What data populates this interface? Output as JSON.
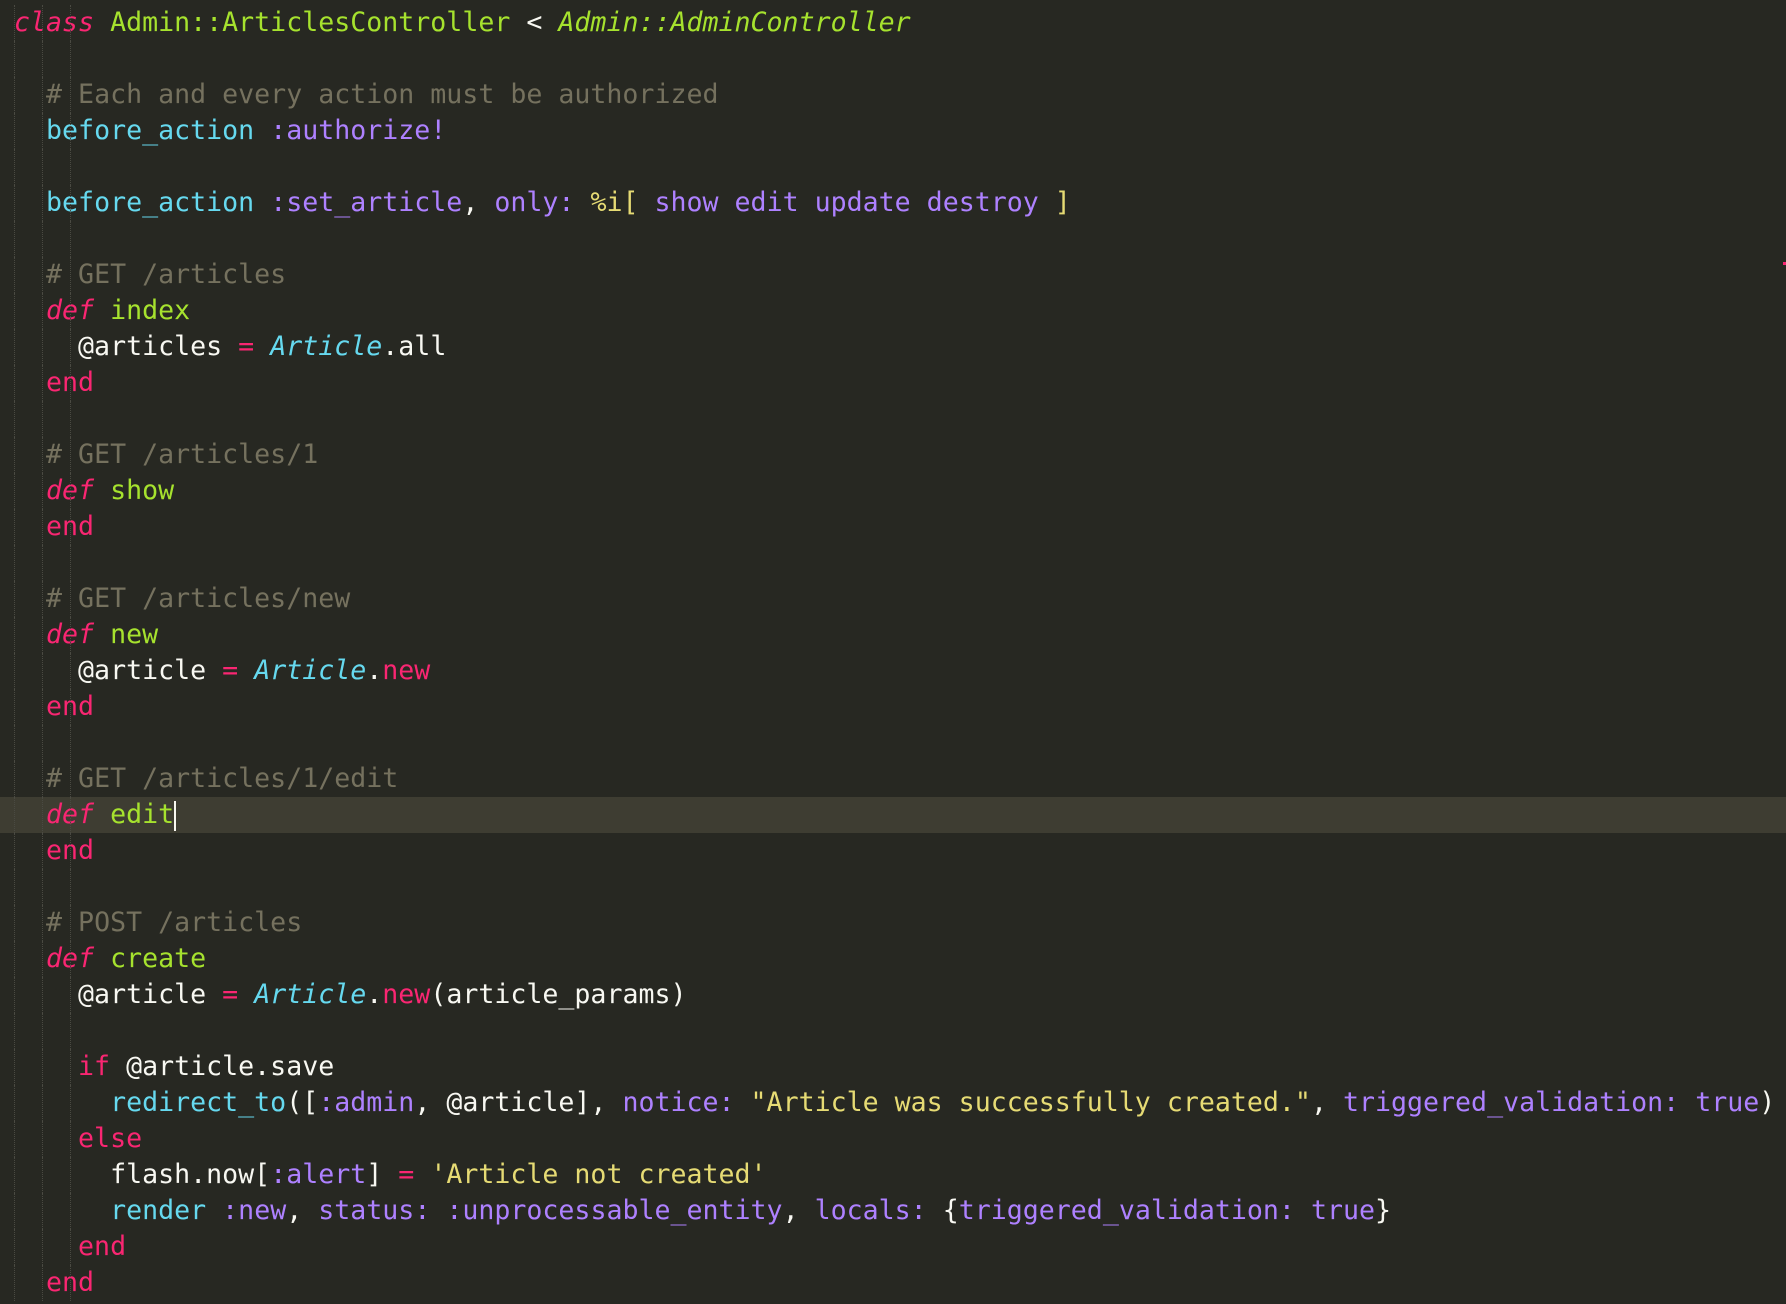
{
  "editor": {
    "theme_colors": {
      "background": "#272822",
      "current_line": "#3E3D32",
      "keyword": "#F92672",
      "function": "#A6E22E",
      "constant": "#66D9EF",
      "symbol": "#AE81FF",
      "string": "#E6DB74",
      "comment": "#75715E",
      "text": "#F8F8F2"
    },
    "cursor": {
      "line": 23,
      "column": 10
    },
    "lines": [
      {
        "indent": 0,
        "tokens": [
          {
            "t": "class",
            "c": "kwi"
          },
          {
            "t": " ",
            "c": "txt"
          },
          {
            "t": "Admin::ArticlesController",
            "c": "cls"
          },
          {
            "t": " < ",
            "c": "txt"
          },
          {
            "t": "Admin::AdminController",
            "c": "inh"
          }
        ]
      },
      {
        "indent": 0,
        "tokens": []
      },
      {
        "indent": 1,
        "tokens": [
          {
            "t": "# Each and every action must be authorized",
            "c": "cmt"
          }
        ]
      },
      {
        "indent": 1,
        "tokens": [
          {
            "t": "before_action",
            "c": "func"
          },
          {
            "t": " ",
            "c": "txt"
          },
          {
            "t": ":authorize!",
            "c": "sym"
          }
        ]
      },
      {
        "indent": 0,
        "tokens": []
      },
      {
        "indent": 1,
        "tokens": [
          {
            "t": "before_action",
            "c": "func"
          },
          {
            "t": " ",
            "c": "txt"
          },
          {
            "t": ":set_article",
            "c": "sym"
          },
          {
            "t": ", ",
            "c": "txt"
          },
          {
            "t": "only:",
            "c": "kwd"
          },
          {
            "t": " ",
            "c": "txt"
          },
          {
            "t": "%i[",
            "c": "str"
          },
          {
            "t": " show edit update destroy ",
            "c": "sym"
          },
          {
            "t": "]",
            "c": "str"
          }
        ]
      },
      {
        "indent": 0,
        "tokens": []
      },
      {
        "indent": 1,
        "tokens": [
          {
            "t": "# GET /articles",
            "c": "cmt"
          }
        ]
      },
      {
        "indent": 1,
        "tokens": [
          {
            "t": "def",
            "c": "kwi"
          },
          {
            "t": " ",
            "c": "txt"
          },
          {
            "t": "index",
            "c": "def"
          }
        ]
      },
      {
        "indent": 2,
        "tokens": [
          {
            "t": "@articles",
            "c": "txt"
          },
          {
            "t": " ",
            "c": "txt"
          },
          {
            "t": "=",
            "c": "op"
          },
          {
            "t": " ",
            "c": "txt"
          },
          {
            "t": "Article",
            "c": "const"
          },
          {
            "t": ".all",
            "c": "txt"
          }
        ]
      },
      {
        "indent": 1,
        "tokens": [
          {
            "t": "end",
            "c": "kw"
          }
        ]
      },
      {
        "indent": 0,
        "tokens": []
      },
      {
        "indent": 1,
        "tokens": [
          {
            "t": "# GET /articles/1",
            "c": "cmt"
          }
        ]
      },
      {
        "indent": 1,
        "tokens": [
          {
            "t": "def",
            "c": "kwi"
          },
          {
            "t": " ",
            "c": "txt"
          },
          {
            "t": "show",
            "c": "def"
          }
        ]
      },
      {
        "indent": 1,
        "tokens": [
          {
            "t": "end",
            "c": "kw"
          }
        ]
      },
      {
        "indent": 0,
        "tokens": []
      },
      {
        "indent": 1,
        "tokens": [
          {
            "t": "# GET /articles/new",
            "c": "cmt"
          }
        ]
      },
      {
        "indent": 1,
        "tokens": [
          {
            "t": "def",
            "c": "kwi"
          },
          {
            "t": " ",
            "c": "txt"
          },
          {
            "t": "new",
            "c": "def"
          }
        ]
      },
      {
        "indent": 2,
        "tokens": [
          {
            "t": "@article",
            "c": "txt"
          },
          {
            "t": " ",
            "c": "txt"
          },
          {
            "t": "=",
            "c": "op"
          },
          {
            "t": " ",
            "c": "txt"
          },
          {
            "t": "Article",
            "c": "const"
          },
          {
            "t": ".",
            "c": "txt"
          },
          {
            "t": "new",
            "c": "kw"
          }
        ]
      },
      {
        "indent": 1,
        "tokens": [
          {
            "t": "end",
            "c": "kw"
          }
        ]
      },
      {
        "indent": 0,
        "tokens": []
      },
      {
        "indent": 1,
        "tokens": [
          {
            "t": "# GET /articles/1/edit",
            "c": "cmt"
          }
        ]
      },
      {
        "indent": 1,
        "current": true,
        "tokens": [
          {
            "t": "def",
            "c": "kwi"
          },
          {
            "t": " ",
            "c": "txt"
          },
          {
            "t": "edit",
            "c": "def"
          }
        ]
      },
      {
        "indent": 1,
        "tokens": [
          {
            "t": "end",
            "c": "kw"
          }
        ]
      },
      {
        "indent": 0,
        "tokens": []
      },
      {
        "indent": 1,
        "tokens": [
          {
            "t": "# POST /articles",
            "c": "cmt"
          }
        ]
      },
      {
        "indent": 1,
        "tokens": [
          {
            "t": "def",
            "c": "kwi"
          },
          {
            "t": " ",
            "c": "txt"
          },
          {
            "t": "create",
            "c": "def"
          }
        ]
      },
      {
        "indent": 2,
        "tokens": [
          {
            "t": "@article",
            "c": "txt"
          },
          {
            "t": " ",
            "c": "txt"
          },
          {
            "t": "=",
            "c": "op"
          },
          {
            "t": " ",
            "c": "txt"
          },
          {
            "t": "Article",
            "c": "const"
          },
          {
            "t": ".",
            "c": "txt"
          },
          {
            "t": "new",
            "c": "kw"
          },
          {
            "t": "(article_params)",
            "c": "txt"
          }
        ]
      },
      {
        "indent": 0,
        "tokens": []
      },
      {
        "indent": 2,
        "tokens": [
          {
            "t": "if",
            "c": "kw"
          },
          {
            "t": " @article.save",
            "c": "txt"
          }
        ]
      },
      {
        "indent": 3,
        "tokens": [
          {
            "t": "redirect_to",
            "c": "func"
          },
          {
            "t": "([",
            "c": "txt"
          },
          {
            "t": ":admin",
            "c": "sym"
          },
          {
            "t": ", @article], ",
            "c": "txt"
          },
          {
            "t": "notice:",
            "c": "kwd"
          },
          {
            "t": " ",
            "c": "txt"
          },
          {
            "t": "\"Article was successfully created.\"",
            "c": "str"
          },
          {
            "t": ", ",
            "c": "txt"
          },
          {
            "t": "triggered_validation:",
            "c": "kwd"
          },
          {
            "t": " ",
            "c": "txt"
          },
          {
            "t": "true",
            "c": "sym"
          },
          {
            "t": ")",
            "c": "txt"
          }
        ]
      },
      {
        "indent": 2,
        "tokens": [
          {
            "t": "else",
            "c": "kw"
          }
        ]
      },
      {
        "indent": 3,
        "tokens": [
          {
            "t": "flash.now[",
            "c": "txt"
          },
          {
            "t": ":alert",
            "c": "sym"
          },
          {
            "t": "] ",
            "c": "txt"
          },
          {
            "t": "=",
            "c": "op"
          },
          {
            "t": " ",
            "c": "txt"
          },
          {
            "t": "'Article not created'",
            "c": "str"
          }
        ]
      },
      {
        "indent": 3,
        "tokens": [
          {
            "t": "render",
            "c": "func"
          },
          {
            "t": " ",
            "c": "txt"
          },
          {
            "t": ":new",
            "c": "sym"
          },
          {
            "t": ", ",
            "c": "txt"
          },
          {
            "t": "status:",
            "c": "kwd"
          },
          {
            "t": " ",
            "c": "txt"
          },
          {
            "t": ":unprocessable_entity",
            "c": "sym"
          },
          {
            "t": ", ",
            "c": "txt"
          },
          {
            "t": "locals:",
            "c": "kwd"
          },
          {
            "t": " {",
            "c": "txt"
          },
          {
            "t": "triggered_validation:",
            "c": "kwd"
          },
          {
            "t": " ",
            "c": "txt"
          },
          {
            "t": "true",
            "c": "sym"
          },
          {
            "t": "}",
            "c": "txt"
          }
        ]
      },
      {
        "indent": 2,
        "tokens": [
          {
            "t": "end",
            "c": "kw"
          }
        ]
      },
      {
        "indent": 1,
        "tokens": [
          {
            "t": "end",
            "c": "kw"
          }
        ]
      }
    ]
  }
}
